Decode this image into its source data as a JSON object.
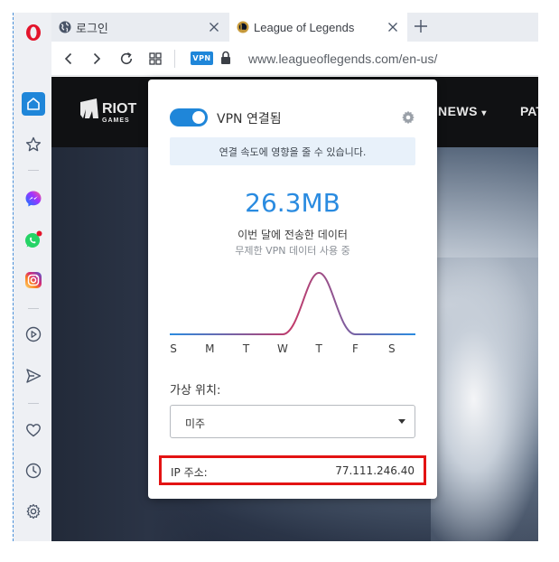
{
  "browser": {
    "tabs": [
      {
        "label": "로그인",
        "active": false
      },
      {
        "label": "League of Legends",
        "active": true
      }
    ],
    "address": {
      "vpn_badge": "VPN",
      "url": "www.leagueoflegends.com/en-us/"
    }
  },
  "page": {
    "brand": "RIOT GAMES",
    "nav": [
      "NEWS",
      "PAT"
    ]
  },
  "vpn_popup": {
    "status": "VPN 연결됨",
    "enabled": true,
    "notice": "연결 속도에 영향을 줄 수 있습니다.",
    "data_amount": "26.3MB",
    "data_label": "이번 달에 전송한 데이터",
    "data_sub": "무제한 VPN 데이터 사용 중",
    "weekdays": [
      "S",
      "M",
      "T",
      "W",
      "T",
      "F",
      "S"
    ],
    "usage_by_day": [
      0,
      0,
      0,
      0,
      1,
      0,
      0
    ],
    "location_label": "가상 위치:",
    "location_value": "미주",
    "ip_label": "IP 주소:",
    "ip_value": "77.111.246.40"
  },
  "colors": {
    "accent": "#1f86d9",
    "highlight_border": "#e31313"
  }
}
